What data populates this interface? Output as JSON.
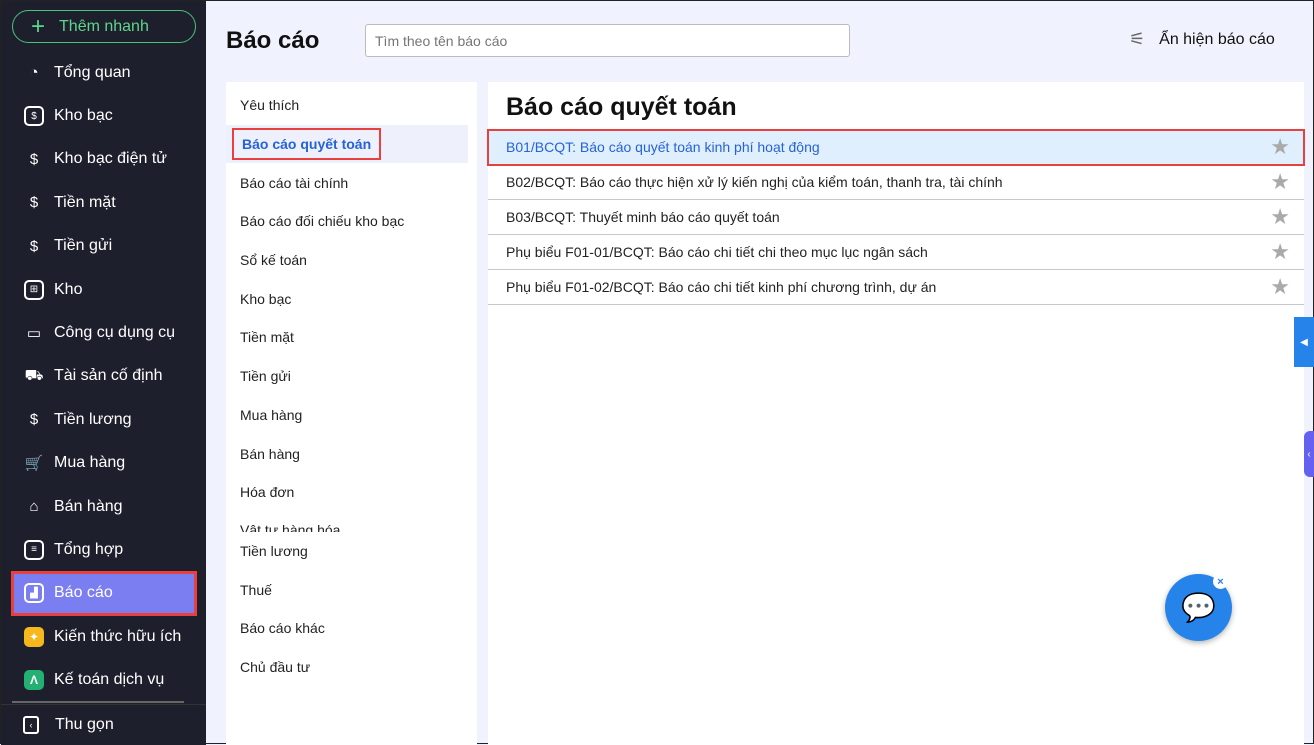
{
  "sidebar": {
    "quick_add": "Thêm nhanh",
    "items": [
      {
        "label": "Tổng quan",
        "icon": "pie-chart-icon",
        "glyph": "◔"
      },
      {
        "label": "Kho bạc",
        "icon": "treasury-icon",
        "glyph": "$"
      },
      {
        "label": "Kho bạc điện tử",
        "icon": "e-treasury-icon",
        "glyph": "$"
      },
      {
        "label": "Tiền mặt",
        "icon": "cash-wallet-icon",
        "glyph": "$"
      },
      {
        "label": "Tiền gửi",
        "icon": "deposit-icon",
        "glyph": "$"
      },
      {
        "label": "Kho",
        "icon": "warehouse-icon",
        "glyph": "⊞"
      },
      {
        "label": "Công cụ dụng cụ",
        "icon": "tools-icon",
        "glyph": "▭"
      },
      {
        "label": "Tài sản cố định",
        "icon": "truck-icon",
        "glyph": "⛟"
      },
      {
        "label": "Tiền lương",
        "icon": "briefcase-icon",
        "glyph": "$"
      },
      {
        "label": "Mua hàng",
        "icon": "cart-icon",
        "glyph": "🛒"
      },
      {
        "label": "Bán hàng",
        "icon": "store-icon",
        "glyph": "⌂"
      },
      {
        "label": "Tổng hợp",
        "icon": "ledger-icon",
        "glyph": "≡"
      },
      {
        "label": "Báo cáo",
        "icon": "report-chart-icon",
        "glyph": "▟"
      },
      {
        "label": "Kiến thức hữu ích",
        "icon": "book-icon",
        "glyph": "✦"
      },
      {
        "label": "Kế toán dịch vụ",
        "icon": "service-logo-icon",
        "glyph": "Λ"
      }
    ],
    "collapse": "Thu gọn"
  },
  "header": {
    "title": "Báo cáo",
    "search_placeholder": "Tìm theo tên báo cáo",
    "toggle_label": "Ẩn hiện báo cáo"
  },
  "categories": [
    "Yêu thích",
    "Báo cáo quyết toán",
    "Báo cáo tài chính",
    "Báo cáo đối chiếu kho bạc",
    "Sổ kế toán",
    "Kho bạc",
    "Tiền mặt",
    "Tiền gửi",
    "Mua hàng",
    "Bán hàng",
    "Hóa đơn",
    "Vật tư hàng hóa",
    "Tiền lương",
    "Thuế",
    "Báo cáo khác",
    "Chủ đầu tư"
  ],
  "main": {
    "heading": "Báo cáo quyết toán",
    "reports": [
      "B01/BCQT: Báo cáo quyết toán kinh phí hoạt động",
      "B02/BCQT: Báo cáo thực hiện xử lý kiến nghị của kiểm toán, thanh tra, tài chính",
      "B03/BCQT: Thuyết minh báo cáo quyết toán",
      "Phụ biểu F01-01/BCQT: Báo cáo chi tiết chi theo mục lục ngân sách",
      "Phụ biểu F01-02/BCQT: Báo cáo chi tiết kinh phí chương trình, dự án"
    ]
  }
}
